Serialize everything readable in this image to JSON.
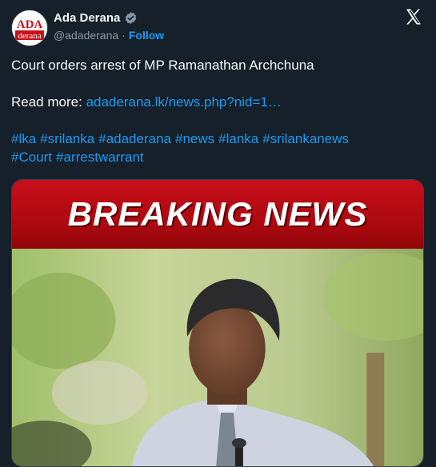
{
  "account": {
    "display_name": "Ada Derana",
    "handle": "@adaderana",
    "separator": "·",
    "follow_label": "Follow",
    "logo_text_top": "ADA",
    "logo_text_bottom": "derana"
  },
  "tweet": {
    "text": "Court orders arrest of MP Ramanathan Archchuna",
    "read_more_prefix": "Read more:",
    "link_text": "adaderana.lk/news.php?nid=1…",
    "hashtags_line1": [
      "#lka",
      "#srilanka",
      "#adaderana",
      "#news",
      "#lanka",
      "#srilankanews"
    ],
    "hashtags_line2": [
      "#Court",
      "#arrestwarrant"
    ]
  },
  "media": {
    "banner_text": "BREAKING NEWS"
  },
  "colors": {
    "background": "#15202b",
    "link": "#1d9bf0",
    "banner_red": "#c8101a",
    "verified": "#8b98a5"
  },
  "icons": {
    "verified": "verified-badge-icon",
    "platform": "x-logo-icon"
  }
}
